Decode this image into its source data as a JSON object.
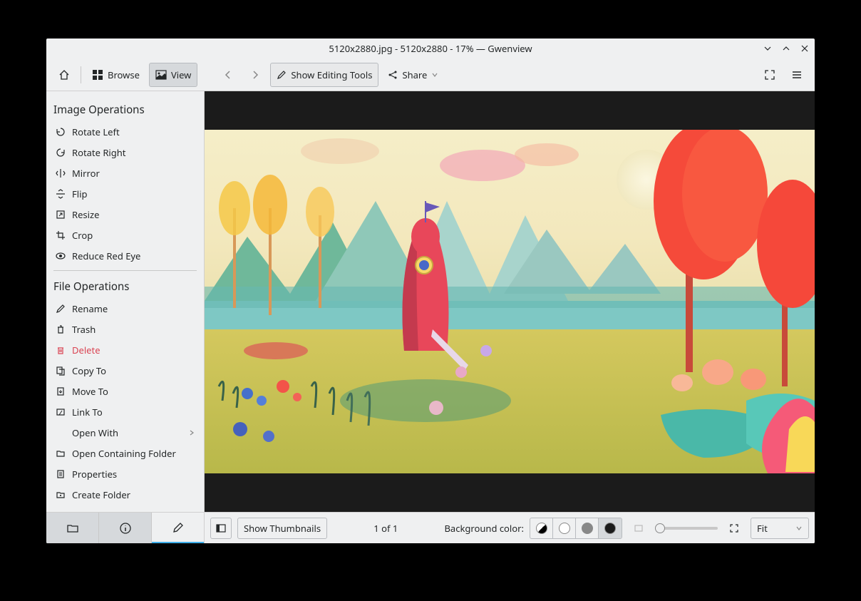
{
  "titlebar": {
    "text": "5120x2880.jpg - 5120x2880 - 17% — Gwenview"
  },
  "toolbar": {
    "browse_label": "Browse",
    "view_label": "View",
    "show_editing_label": "Show Editing Tools",
    "share_label": "Share"
  },
  "sidebar": {
    "image_ops_title": "Image Operations",
    "image_ops": [
      {
        "label": "Rotate Left",
        "icon": "rotate-left-icon"
      },
      {
        "label": "Rotate Right",
        "icon": "rotate-right-icon"
      },
      {
        "label": "Mirror",
        "icon": "mirror-icon"
      },
      {
        "label": "Flip",
        "icon": "flip-icon"
      },
      {
        "label": "Resize",
        "icon": "resize-icon"
      },
      {
        "label": "Crop",
        "icon": "crop-icon"
      },
      {
        "label": "Reduce Red Eye",
        "icon": "red-eye-icon"
      }
    ],
    "file_ops_title": "File Operations",
    "file_ops": [
      {
        "label": "Rename",
        "icon": "rename-icon"
      },
      {
        "label": "Trash",
        "icon": "trash-icon"
      },
      {
        "label": "Delete",
        "icon": "delete-icon",
        "danger": true
      },
      {
        "label": "Copy To",
        "icon": "copy-icon"
      },
      {
        "label": "Move To",
        "icon": "move-icon"
      },
      {
        "label": "Link To",
        "icon": "link-icon"
      },
      {
        "label": "Open With",
        "submenu": true
      },
      {
        "label": "Open Containing Folder",
        "icon": "folder-icon"
      },
      {
        "label": "Properties",
        "icon": "properties-icon"
      },
      {
        "label": "Create Folder",
        "icon": "create-folder-icon"
      }
    ]
  },
  "statusbar": {
    "show_thumbnails_label": "Show Thumbnails",
    "page_text": "1 of 1",
    "bg_color_label": "Background color:",
    "zoom_select_label": "Fit"
  }
}
